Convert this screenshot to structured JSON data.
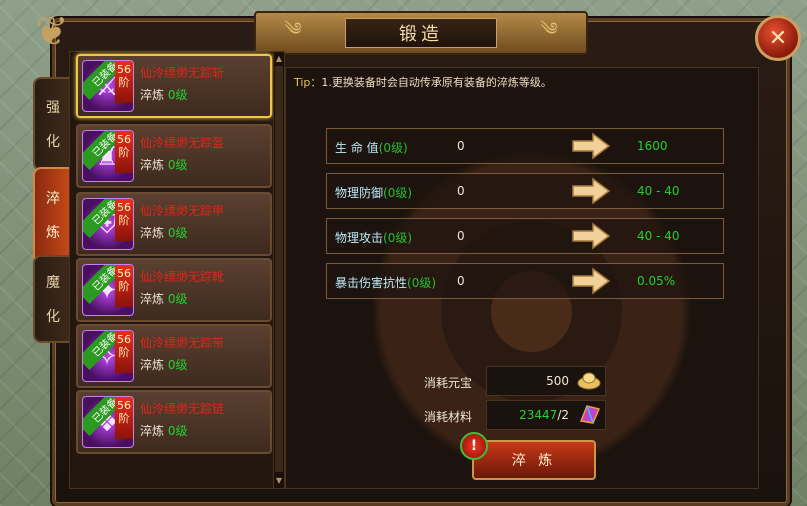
{
  "window": {
    "title": "锻造"
  },
  "tabs": [
    {
      "label_1": "强",
      "label_2": "化"
    },
    {
      "label_1": "淬",
      "label_2": "炼"
    },
    {
      "label_1": "魔",
      "label_2": "化"
    }
  ],
  "tip": {
    "prefix": "Tip：",
    "text": "1.更换装备时会自动传承原有装备的淬炼等级。"
  },
  "items": [
    {
      "name": "仙泠缥缈无踪斩",
      "sub_label": "淬炼",
      "level": "0级",
      "badge": "已装备",
      "tier_1": "56",
      "tier_2": "阶"
    },
    {
      "name": "仙泠缥缈无踪盔",
      "sub_label": "淬炼",
      "level": "0级",
      "badge": "已装备",
      "tier_1": "56",
      "tier_2": "阶"
    },
    {
      "name": "仙泠缥缈无踪甲",
      "sub_label": "淬炼",
      "level": "0级",
      "badge": "已装备",
      "tier_1": "56",
      "tier_2": "阶"
    },
    {
      "name": "仙泠缥缈无踪靴",
      "sub_label": "淬炼",
      "level": "0级",
      "badge": "已装备",
      "tier_1": "56",
      "tier_2": "阶"
    },
    {
      "name": "仙泠缥缈无踪带",
      "sub_label": "淬炼",
      "level": "0级",
      "badge": "已装备",
      "tier_1": "56",
      "tier_2": "阶"
    },
    {
      "name": "仙泠缥缈无踪链",
      "sub_label": "淬炼",
      "level": "0级",
      "badge": "已装备",
      "tier_1": "56",
      "tier_2": "阶"
    }
  ],
  "stats": [
    {
      "name": "生 命 值",
      "level": "(0级)",
      "current": "0",
      "next": "1600"
    },
    {
      "name": "物理防御",
      "level": "(0级)",
      "current": "0",
      "next": "40 - 40"
    },
    {
      "name": "物理攻击",
      "level": "(0级)",
      "current": "0",
      "next": "40 - 40"
    },
    {
      "name": "暴击伤害抗性",
      "level": "(0级)",
      "current": "0",
      "next": "0.05%"
    }
  ],
  "costs": {
    "gold_label": "消耗元宝",
    "gold_value": "500",
    "material_label": "消耗材料",
    "material_have": "23447",
    "material_need": "/2"
  },
  "refine_button": {
    "label": "淬 炼",
    "alert": "!"
  },
  "icons": {
    "close": "close-icon",
    "gold": "ingot-icon",
    "material": "crystal-icon",
    "arrow": "arrow-right-icon"
  }
}
